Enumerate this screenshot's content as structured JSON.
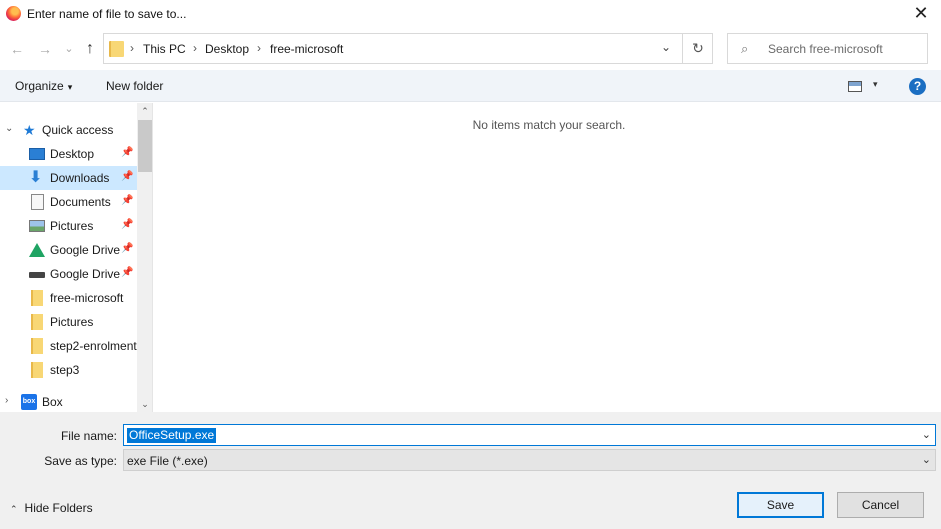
{
  "window": {
    "title": "Enter name of file to save to...",
    "close_glyph": "✕"
  },
  "nav": {
    "back_glyph": "←",
    "forward_glyph": "→",
    "recent_glyph": "⌄",
    "up_glyph": "↑",
    "breadcrumbs": [
      "This PC",
      "Desktop",
      "free-microsoft"
    ],
    "breadcrumb_separator": "›",
    "dropdown_glyph": "⌄",
    "refresh_glyph": "↻"
  },
  "search": {
    "placeholder": "Search free-microsoft",
    "icon_glyph": "⌕"
  },
  "toolbar": {
    "organize_label": "Organize",
    "caret_glyph": "▾",
    "new_folder_label": "New folder",
    "help_glyph": "?"
  },
  "sidebar": {
    "items": [
      {
        "label": "Quick access",
        "icon": "star-icon",
        "pinned": false,
        "expanded": true
      },
      {
        "label": "Desktop",
        "icon": "desktop-icon",
        "pinned": true
      },
      {
        "label": "Downloads",
        "icon": "download-icon",
        "pinned": true,
        "selected": true
      },
      {
        "label": "Documents",
        "icon": "document-icon",
        "pinned": true
      },
      {
        "label": "Pictures",
        "icon": "pictures-icon",
        "pinned": true
      },
      {
        "label": "Google Drive",
        "icon": "google-drive-icon",
        "pinned": true
      },
      {
        "label": "Google Drive",
        "icon": "drive-icon",
        "pinned": true
      },
      {
        "label": "free-microsoft",
        "icon": "folder-icon",
        "pinned": false
      },
      {
        "label": "Pictures",
        "icon": "folder-icon",
        "pinned": false
      },
      {
        "label": "step2-enrolment",
        "icon": "folder-icon",
        "pinned": false
      },
      {
        "label": "step3",
        "icon": "folder-icon",
        "pinned": false
      },
      {
        "label": "Box",
        "icon": "box-icon",
        "pinned": false,
        "collapsed": true
      }
    ],
    "pin_glyph": "📌",
    "expanded_chevron": "⌄",
    "collapsed_chevron": "›",
    "box_text": "box",
    "star_glyph": "★",
    "download_glyph": "⬇"
  },
  "scrollbar": {
    "up_glyph": "⌃",
    "down_glyph": "⌄"
  },
  "content": {
    "empty_message": "No items match your search."
  },
  "form": {
    "file_name_label": "File name:",
    "file_name_value": "OfficeSetup.exe",
    "save_as_type_label": "Save as type:",
    "save_as_type_value": "exe File (*.exe)",
    "dropdown_glyph": "⌄"
  },
  "footer": {
    "hide_folders_label": "Hide Folders",
    "hide_folders_glyph": "⌃",
    "save_label": "Save",
    "cancel_label": "Cancel"
  },
  "colors": {
    "accent": "#0078d7",
    "selected_bg": "#cce8ff",
    "folder": "#f8d775"
  }
}
